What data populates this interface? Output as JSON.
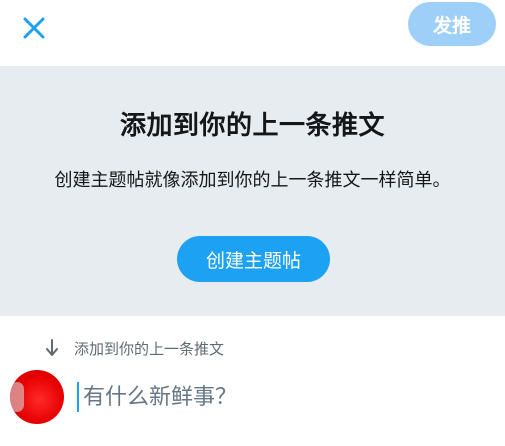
{
  "header": {
    "close_icon": "close-icon",
    "post_label": "发推",
    "post_color": "#9dcff8"
  },
  "banner": {
    "title": "添加到你的上一条推文",
    "description": "创建主题帖就像添加到你的上一条推文一样简单。",
    "button_label": "创建主题帖",
    "button_color": "#1da1f2",
    "background": "#e6ecf0"
  },
  "reply": {
    "icon": "arrow-down-icon",
    "label": "添加到你的上一条推文"
  },
  "compose": {
    "placeholder": "有什么新鲜事？"
  }
}
